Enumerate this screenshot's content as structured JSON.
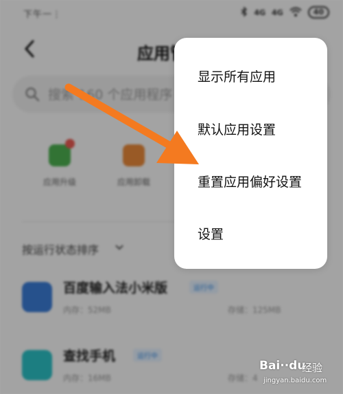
{
  "status_bar": {
    "left_text": "下午一⋮",
    "signal_1": "4G",
    "signal_2": "4G",
    "battery": "40"
  },
  "header": {
    "title": "应用管"
  },
  "search": {
    "placeholder": "搜索 160 个应用程序"
  },
  "quick_actions": [
    {
      "label": "应用升级",
      "icon": "app-upgrade-icon",
      "color": "#4caf50"
    },
    {
      "label": "应用卸载",
      "icon": "app-uninstall-icon",
      "color": "#e8893a"
    }
  ],
  "sort": {
    "label": "按运行状态排序"
  },
  "apps": [
    {
      "name": "百度输入法小米版",
      "tag": "运行中",
      "meta": "内存：52MB",
      "size": "存储：125MB",
      "icon_color": "#3a7bd5"
    },
    {
      "name": "查找手机",
      "tag": "运行中",
      "meta": "内存：16MB",
      "size": "存储：4",
      "icon_color": "#2bbfc4"
    }
  ],
  "menu": {
    "items": [
      "显示所有应用",
      "默认应用设置",
      "重置应用偏好设置",
      "设置"
    ]
  },
  "annotation": {
    "arrow_color": "#f47a20"
  },
  "watermark": {
    "brand": "Bai··du",
    "suffix": "经验",
    "url": "jingyan.baidu.com"
  }
}
